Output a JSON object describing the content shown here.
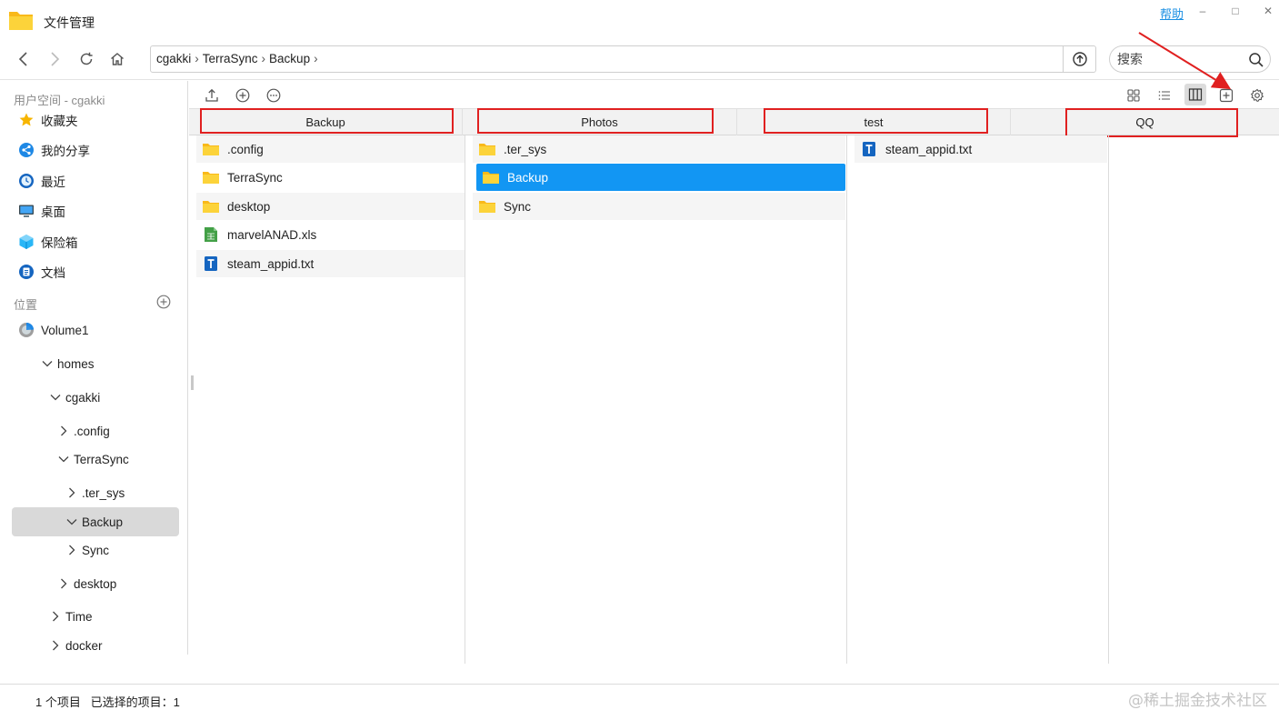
{
  "titlebar": {
    "title": "文件管理",
    "help": "帮助",
    "minimize": "–",
    "maximize": "□",
    "close": "✕"
  },
  "navbar": {
    "breadcrumb": [
      "cgakki",
      "TerraSync",
      "Backup"
    ],
    "search_placeholder": "搜索"
  },
  "sidebar": {
    "user_space_label": "用户空间 - cgakki",
    "items": [
      {
        "label": "收藏夹",
        "icon": "star-icon"
      },
      {
        "label": "我的分享",
        "icon": "share-icon"
      },
      {
        "label": "最近",
        "icon": "clock-icon"
      },
      {
        "label": "桌面",
        "icon": "desktop-icon"
      },
      {
        "label": "保险箱",
        "icon": "safe-icon"
      },
      {
        "label": "文档",
        "icon": "document-icon"
      }
    ],
    "location_label": "位置",
    "volume": "Volume1",
    "tree": [
      {
        "label": "homes",
        "expanded": true
      },
      {
        "label": "cgakki",
        "expanded": true
      },
      {
        "label": ".config",
        "expanded": false
      },
      {
        "label": "TerraSync",
        "expanded": true
      },
      {
        "label": ".ter_sys",
        "expanded": false
      },
      {
        "label": "Backup",
        "expanded": true,
        "selected": true
      },
      {
        "label": "Sync",
        "expanded": false
      },
      {
        "label": "desktop",
        "expanded": false
      },
      {
        "label": "Time",
        "expanded": false
      },
      {
        "label": "docker",
        "expanded": false
      }
    ]
  },
  "columns": {
    "headers": [
      "Backup",
      "Photos",
      "test",
      "QQ"
    ],
    "col1": [
      {
        "name": ".config",
        "type": "folder"
      },
      {
        "name": "TerraSync",
        "type": "folder"
      },
      {
        "name": "desktop",
        "type": "folder"
      },
      {
        "name": "marvelANAD.xls",
        "type": "xls"
      },
      {
        "name": "steam_appid.txt",
        "type": "txt"
      }
    ],
    "col2": [
      {
        "name": ".ter_sys",
        "type": "folder"
      },
      {
        "name": "Backup",
        "type": "folder",
        "selected": true
      },
      {
        "name": "Sync",
        "type": "folder"
      }
    ],
    "col3": [
      {
        "name": "steam_appid.txt",
        "type": "txt"
      }
    ]
  },
  "status": {
    "text": "1 个项目   已选择的项目：1"
  },
  "watermark": "@稀土掘金技术社区",
  "colors": {
    "accent": "#1296f3",
    "annotation": "#e02020",
    "folder": "#fbc02d"
  }
}
